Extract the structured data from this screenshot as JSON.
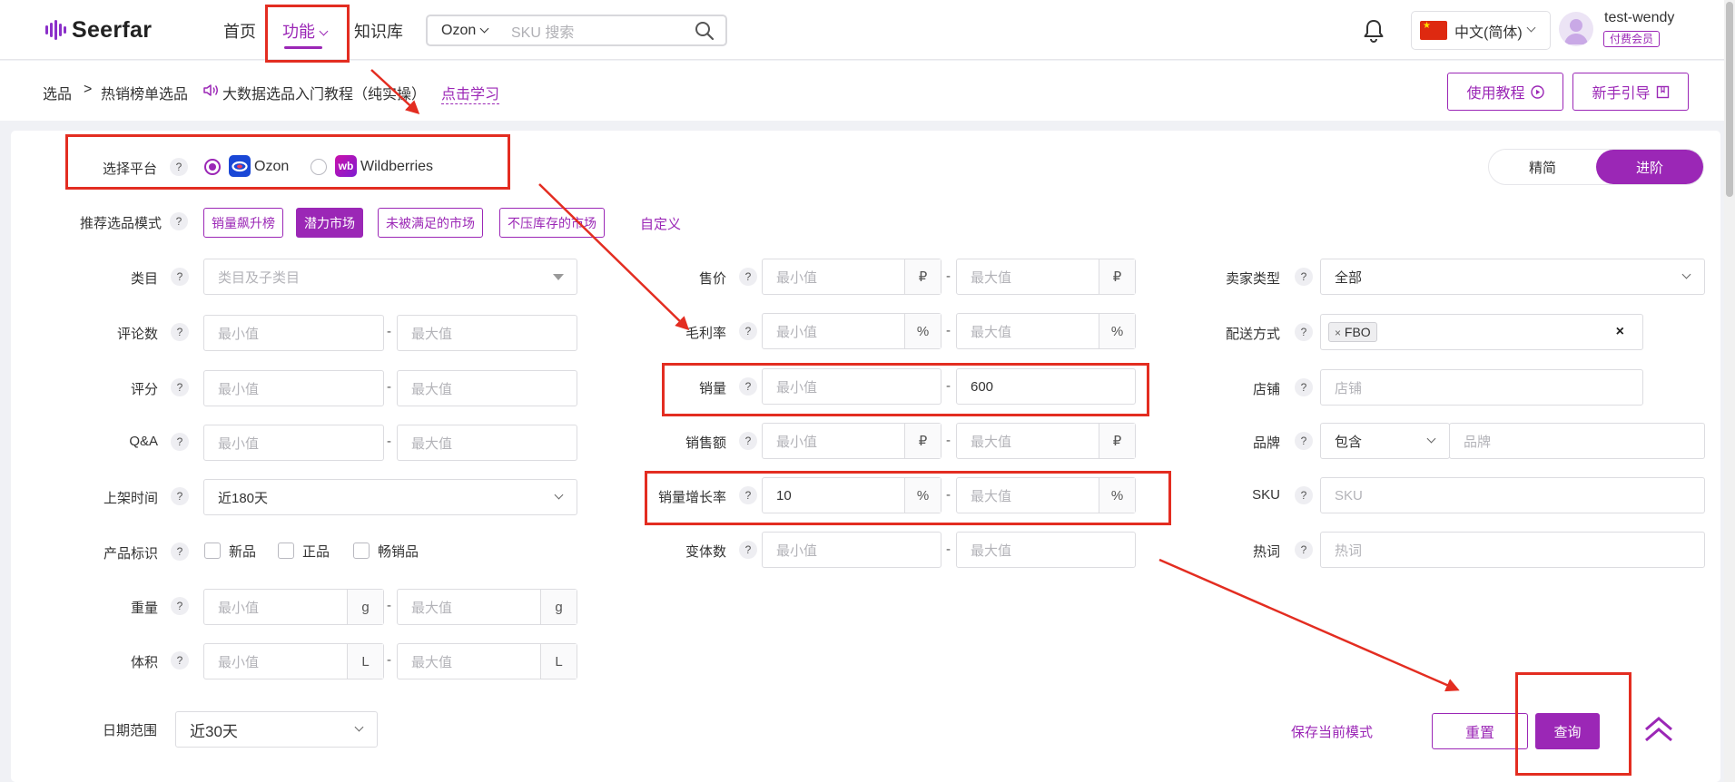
{
  "nav": {
    "brand": "Seerfar",
    "home": "首页",
    "features": "功能",
    "knowledge": "知识库",
    "search_platform": "Ozon",
    "search_placeholder": "SKU 搜索",
    "language": "中文(简体)",
    "username": "test-wendy",
    "member_badge": "付费会员"
  },
  "breadcrumb": {
    "root": "选品",
    "sep": ">",
    "current": "热销榜单选品",
    "promo": "大数据选品入门教程（纯实操）",
    "learn": "点击学习",
    "tutorial_btn": "使用教程",
    "guide_btn": "新手引导"
  },
  "view_toggle": {
    "simple": "精简",
    "advanced": "进阶",
    "selected": "进阶"
  },
  "platform": {
    "label": "选择平台",
    "options": [
      "Ozon",
      "Wildberries"
    ],
    "selected": "Ozon"
  },
  "modes": {
    "label": "推荐选品模式",
    "items": [
      "销量飙升榜",
      "潜力市场",
      "未被满足的市场",
      "不压库存的市场"
    ],
    "active": "潜力市场",
    "custom": "自定义"
  },
  "filters": {
    "min": "最小值",
    "max": "最大值",
    "dash": "-",
    "category": {
      "label": "类目",
      "placeholder": "类目及子类目"
    },
    "reviews": {
      "label": "评论数"
    },
    "rating": {
      "label": "评分"
    },
    "qa": {
      "label": "Q&A"
    },
    "listed": {
      "label": "上架时间",
      "value": "近180天"
    },
    "product_tags": {
      "label": "产品标识",
      "options": [
        "新品",
        "正品",
        "畅销品"
      ]
    },
    "weight": {
      "label": "重量",
      "unit": "g"
    },
    "volume": {
      "label": "体积",
      "unit": "L"
    },
    "price": {
      "label": "售价",
      "unit": "₽"
    },
    "gross_margin": {
      "label": "毛利率",
      "unit": "%"
    },
    "sales": {
      "label": "销量",
      "max_value": "600"
    },
    "revenue": {
      "label": "销售额",
      "unit": "₽"
    },
    "sales_growth": {
      "label": "销量增长率",
      "min_value": "10",
      "unit": "%"
    },
    "variants": {
      "label": "变体数"
    },
    "seller_type": {
      "label": "卖家类型",
      "value": "全部"
    },
    "delivery": {
      "label": "配送方式",
      "tag": "FBO"
    },
    "shop": {
      "label": "店铺",
      "placeholder": "店铺"
    },
    "brand": {
      "label": "品牌",
      "mode": "包含",
      "placeholder": "品牌"
    },
    "sku": {
      "label": "SKU",
      "placeholder": "SKU"
    },
    "keyword": {
      "label": "热词",
      "placeholder": "热词"
    }
  },
  "date_range": {
    "label": "日期范围",
    "value": "近30天"
  },
  "actions": {
    "save_mode": "保存当前模式",
    "reset": "重置",
    "query": "查询"
  },
  "colors": {
    "accent": "#9b27b6",
    "annotation_red": "#e32d21"
  }
}
